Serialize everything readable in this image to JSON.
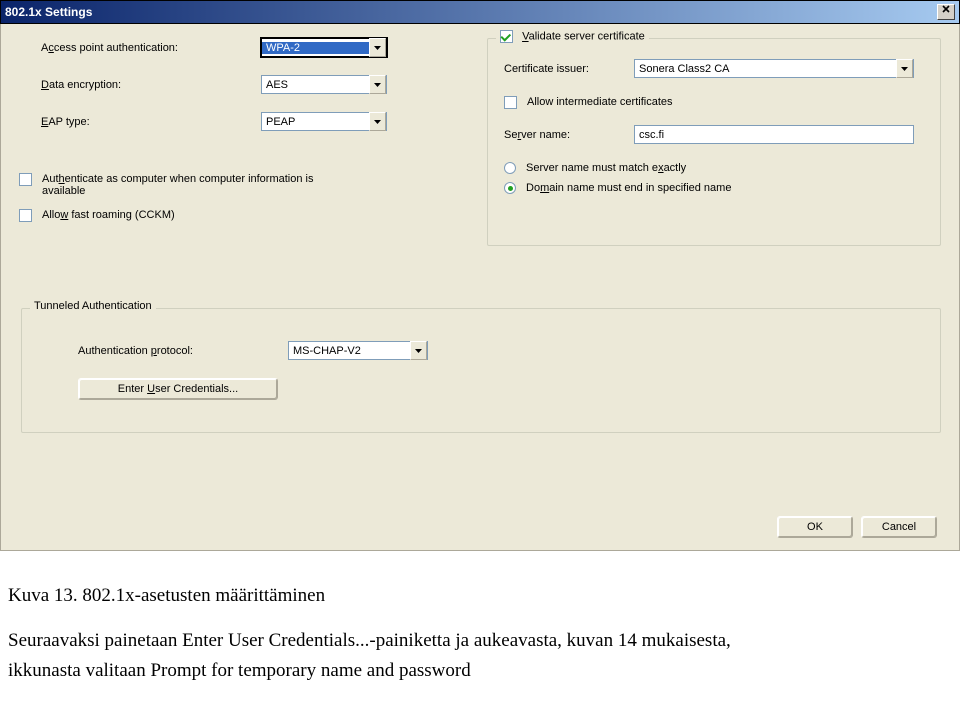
{
  "title": "802.1x Settings",
  "left": {
    "access_point_label": "Access point authentication:",
    "access_point_value": "WPA-2",
    "data_encryption_label": "Data encryption:",
    "data_encryption_value": "AES",
    "eap_type_label": "EAP type:",
    "eap_type_value": "PEAP",
    "auth_as_computer_label_1": "Authenticate as computer when computer information is",
    "auth_as_computer_label_2": "available",
    "allow_fast_roaming_label": "Allow fast roaming (CCKM)"
  },
  "right": {
    "validate_cert_label": "Validate server certificate",
    "cert_issuer_label": "Certificate issuer:",
    "cert_issuer_value": "Sonera Class2 CA",
    "allow_intermediate_label": "Allow intermediate certificates",
    "server_name_label": "Server name:",
    "server_name_value": "csc.fi",
    "match_exactly_label": "Server name must match exactly",
    "end_specified_label": "Domain name must end in specified name"
  },
  "tunnel": {
    "legend": "Tunneled Authentication",
    "auth_protocol_label": "Authentication protocol:",
    "auth_protocol_value": "MS-CHAP-V2",
    "enter_creds_label": "Enter User Credentials..."
  },
  "buttons": {
    "ok": "OK",
    "cancel": "Cancel"
  },
  "caption": {
    "title": "Kuva 13. 802.1x-asetusten määrittäminen",
    "line1": "Seuraavaksi painetaan Enter User Credentials...-painiketta ja aukeavasta, kuvan 14 mukaisesta,",
    "line2": "ikkunasta valitaan Prompt for temporary name and password"
  }
}
